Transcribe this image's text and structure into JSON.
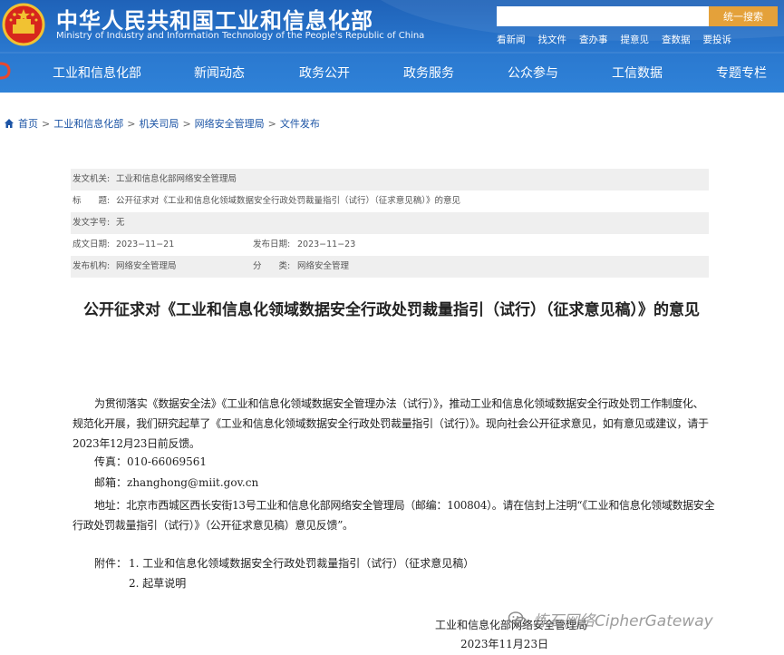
{
  "header": {
    "title": "中华人民共和国工业和信息化部",
    "subtitle": "Ministry of Industry and Information Technology of the People's Republic of China",
    "search_button": "统一搜索",
    "search_placeholder": "",
    "quick_links": [
      "看新闻",
      "找文件",
      "查办事",
      "提意见",
      "查数据",
      "要投诉"
    ],
    "colors": {
      "header_blue": "#2a78cf",
      "search_button": "#e4a13a"
    }
  },
  "nav": {
    "items": [
      "工业和信息化部",
      "新闻动态",
      "政务公开",
      "政务服务",
      "公众参与",
      "工信数据",
      "专题专栏"
    ]
  },
  "breadcrumb": [
    "首页",
    "工业和信息化部",
    "机关司局",
    "网络安全管理局",
    "文件发布"
  ],
  "info": {
    "issuer_label": "发文机关:",
    "issuer": "工业和信息化部网络安全管理局",
    "title_label": "标　　题:",
    "title": "公开征求对《工业和信息化领域数据安全行政处罚裁量指引（试行）（征求意见稿）》的意见",
    "doc_no_label": "发文字号:",
    "doc_no": "无",
    "created_label": "成文日期:",
    "created": "2023−11−21",
    "published_label": "发布日期:",
    "published": "2023−11−23",
    "agency_label": "发布机构:",
    "agency": "网络安全管理局",
    "category_label": "分　　类:",
    "category": "网络安全管理"
  },
  "article": {
    "title": "公开征求对《工业和信息化领域数据安全行政处罚裁量指引（试行）（征求意见稿）》的意见",
    "intro": "为贯彻落实《数据安全法》《工业和信息化领域数据安全管理办法（试行）》，推动工业和信息化领域数据安全行政处罚工作制度化、规范化开展，我们研究起草了《工业和信息化领域数据安全行政处罚裁量指引（试行）》。现向社会公开征求意见，如有意见或建议，请于2023年12月23日前反馈。",
    "fax": "传真：010-66069561",
    "email": "邮箱：zhanghong@miit.gov.cn",
    "address": "地址：北京市西城区西长安街13号工业和信息化部网络安全管理局（邮编：100804）。请在信封上注明“《工业和信息化领域数据安全行政处罚裁量指引（试行）》（公开征求意见稿）意见反馈”。",
    "attachments_label": "附件：",
    "attachment_1": "1. 工业和信息化领域数据安全行政处罚裁量指引（试行）（征求意见稿）",
    "attachment_2": "2. 起草说明",
    "signoff_org": "工业和信息化部网络安全管理局",
    "signoff_date": "2023年11月23日"
  },
  "watermark": {
    "text": "炼石网络CipherGateway",
    "icon": "wechat-icon"
  }
}
